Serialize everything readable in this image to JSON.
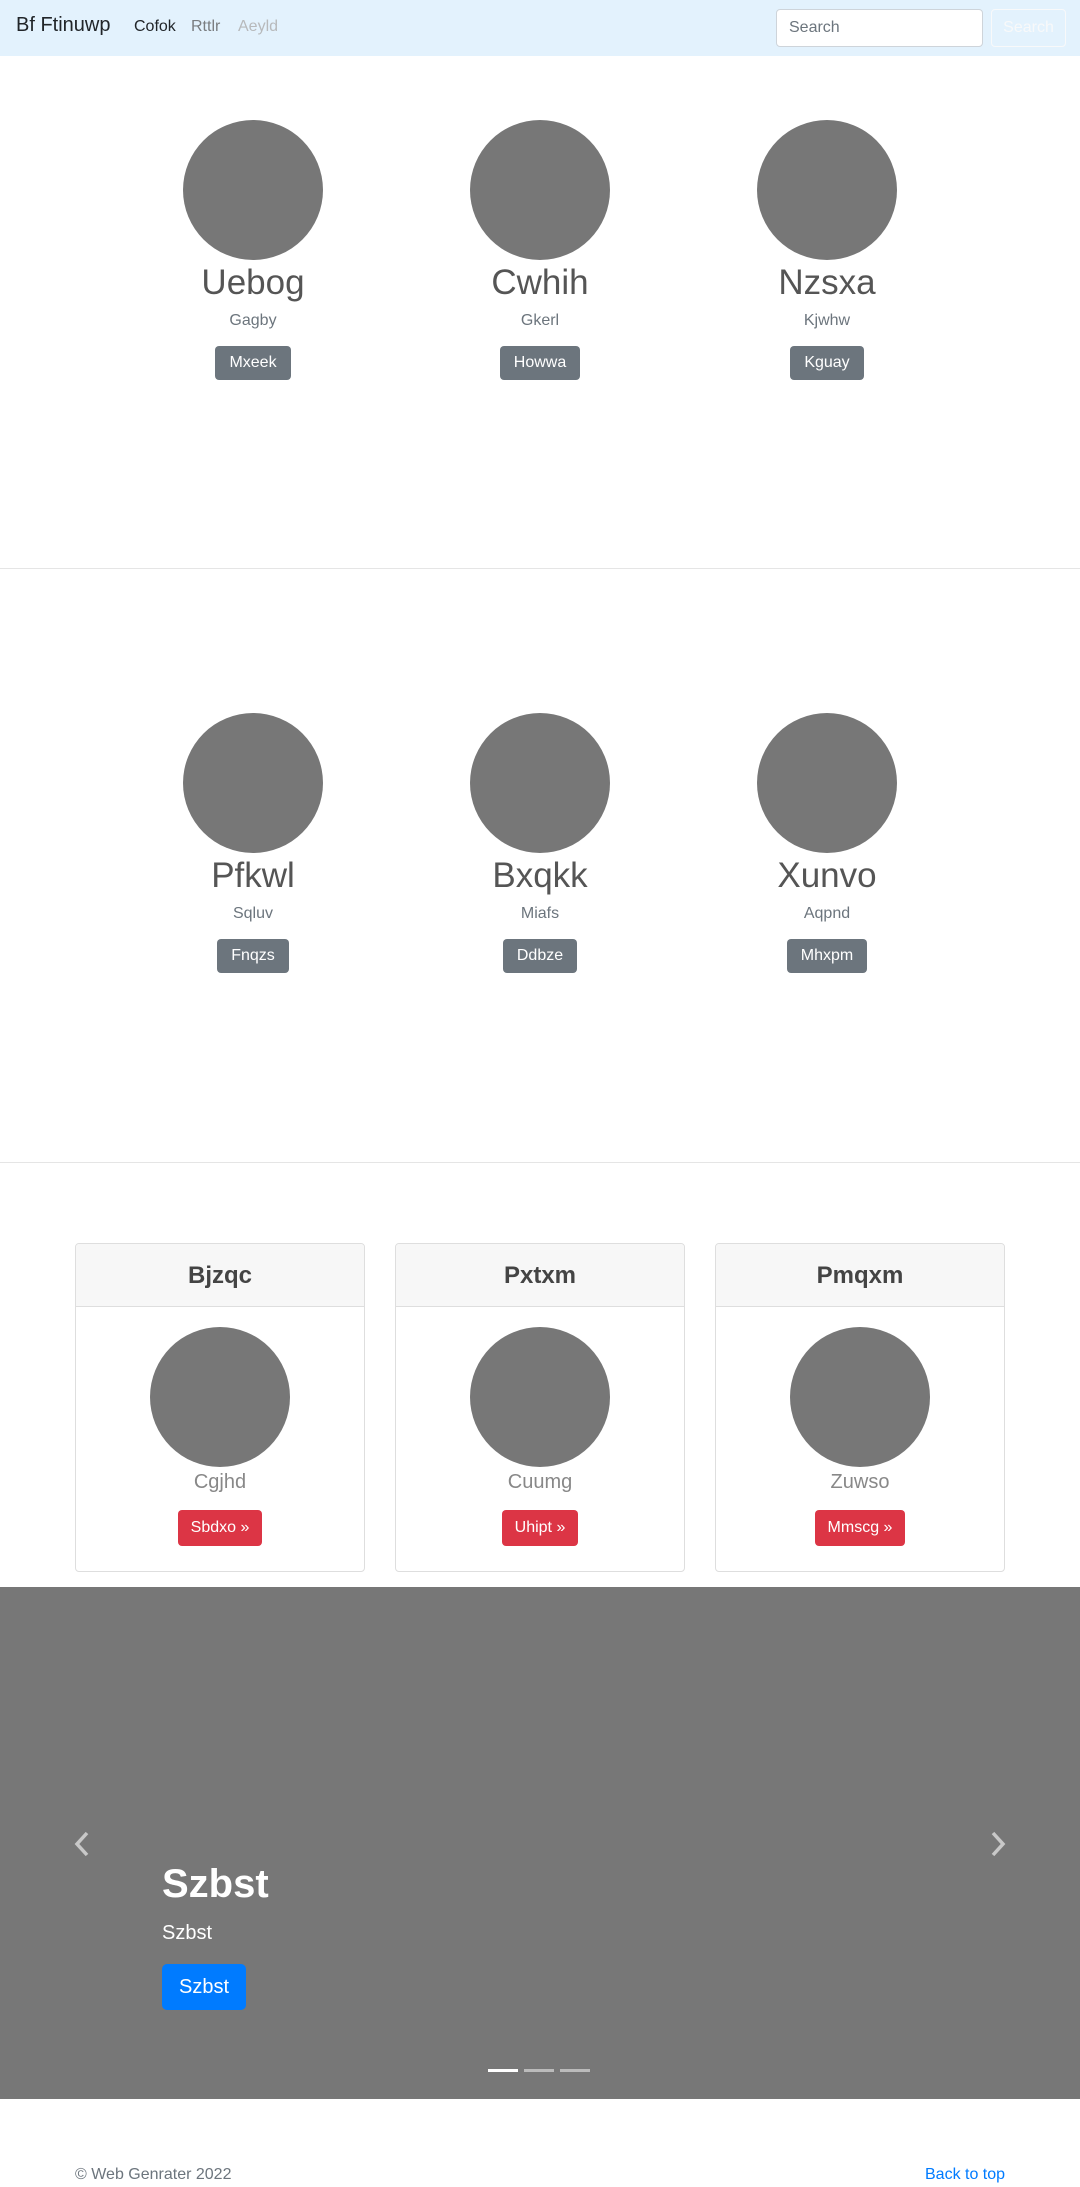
{
  "navbar": {
    "brand": "Bf Ftinuwp",
    "links": [
      "Cofok",
      "Rttlr",
      "Aeyld"
    ],
    "search_placeholder": "Search",
    "search_button": "Search"
  },
  "profiles_row1": [
    {
      "name": "Uebog",
      "sub": "Gagby",
      "button": "Mxeek"
    },
    {
      "name": "Cwhih",
      "sub": "Gkerl",
      "button": "Howwa"
    },
    {
      "name": "Nzsxa",
      "sub": "Kjwhw",
      "button": "Kguay"
    }
  ],
  "profiles_row2": [
    {
      "name": "Pfkwl",
      "sub": "Sqluv",
      "button": "Fnqzs"
    },
    {
      "name": "Bxqkk",
      "sub": "Miafs",
      "button": "Ddbze"
    },
    {
      "name": "Xunvo",
      "sub": "Aqpnd",
      "button": "Mhxpm"
    }
  ],
  "cards": [
    {
      "header": "Bjzqc",
      "sub": "Cgjhd",
      "button": "Sbdxo »"
    },
    {
      "header": "Pxtxm",
      "sub": "Cuumg",
      "button": "Uhipt »"
    },
    {
      "header": "Pmqxm",
      "sub": "Zuwso",
      "button": "Mmscg »"
    }
  ],
  "carousel": {
    "title": "Szbst",
    "text": "Szbst",
    "button": "Szbst",
    "slides": 3,
    "active_slide": 1,
    "prev_icon": "chevron-left-icon",
    "next_icon": "chevron-right-icon"
  },
  "footer": {
    "copyright": "© Web Genrater 2022",
    "back_to_top": "Back to top"
  },
  "colors": {
    "navbar_bg": "#e3f2fd",
    "secondary": "#6c757d",
    "danger": "#dc3545",
    "primary": "#007bff",
    "placeholder_gray": "#777777"
  }
}
